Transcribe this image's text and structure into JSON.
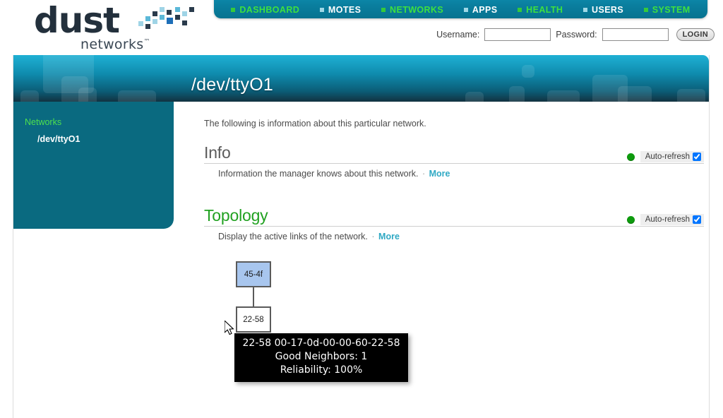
{
  "brand": {
    "name": "dust",
    "tagline": "networks",
    "trademark": "™"
  },
  "nav": {
    "items": [
      {
        "label": "DASHBOARD",
        "active": true
      },
      {
        "label": "MOTES",
        "active": false
      },
      {
        "label": "NETWORKS",
        "active": true
      },
      {
        "label": "APPS",
        "active": false
      },
      {
        "label": "HEALTH",
        "active": true
      },
      {
        "label": "USERS",
        "active": false
      },
      {
        "label": "SYSTEM",
        "active": true
      }
    ],
    "active_color": "#3ee03f",
    "inactive_color": "#ffffff",
    "bar_color": "#0a7e9e"
  },
  "login": {
    "username_label": "Username:",
    "username_value": "",
    "username_placeholder": "",
    "password_label": "Password:",
    "password_value": "",
    "password_placeholder": "",
    "button_label": "LOGIN"
  },
  "banner": {
    "title": "/dev/ttyO1"
  },
  "sidebar": {
    "group_label": "Networks",
    "items": [
      {
        "label": "/dev/ttyO1",
        "selected": true
      }
    ]
  },
  "main": {
    "intro": "The following is information about this particular network.",
    "sections": [
      {
        "title": "Info",
        "title_color": "#5b5b5b",
        "description": "Information the manager knows about this network.",
        "separator": "·",
        "more_label": "More",
        "status": "online",
        "status_color": "#0e9b0e",
        "refresh_label": "Auto-refresh",
        "refresh_checked": true
      },
      {
        "title": "Topology",
        "title_color": "#21a121",
        "description": "Display the active links of the network.",
        "separator": "·",
        "more_label": "More",
        "status": "online",
        "status_color": "#0e9b0e",
        "refresh_label": "Auto-refresh",
        "refresh_checked": true
      }
    ]
  },
  "topology": {
    "nodes": [
      {
        "id": "45-4f",
        "label": "45-4f",
        "type": "manager",
        "fill": "#a8c6ee"
      },
      {
        "id": "22-58",
        "label": "22-58",
        "type": "mote",
        "fill": "#ffffff"
      }
    ],
    "edges": [
      {
        "from": "45-4f",
        "to": "22-58"
      }
    ]
  },
  "tooltip": {
    "line1": "22-58 00-17-0d-00-00-60-22-58",
    "line2": "Good Neighbors: 1",
    "line3": "Reliability: 100%"
  }
}
